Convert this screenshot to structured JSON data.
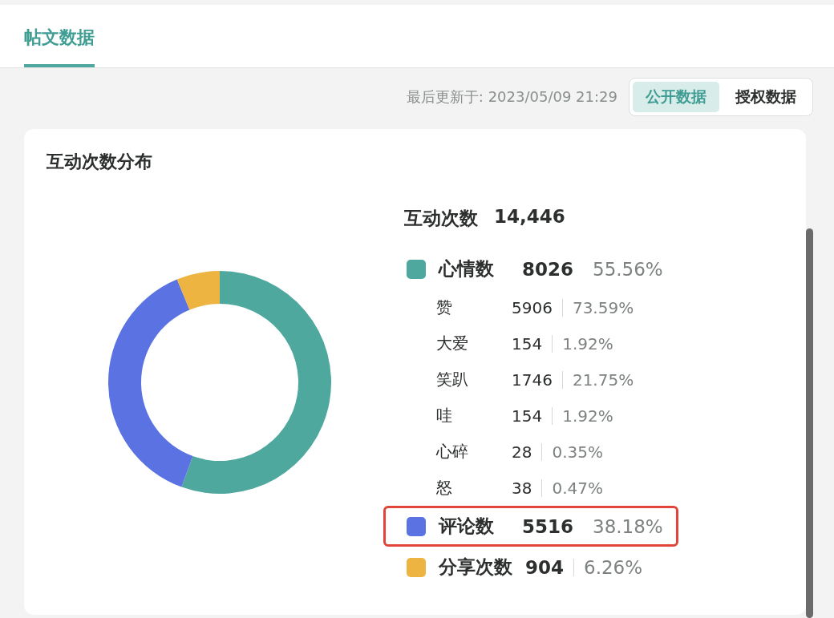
{
  "tabs": [
    {
      "label": "帖文数据",
      "selected": true
    }
  ],
  "last_updated": "最后更新于: 2023/05/09 21:29",
  "data_toggle": [
    {
      "label": "公开数据",
      "selected": true
    },
    {
      "label": "授权数据",
      "selected": false
    }
  ],
  "card": {
    "title": "互动次数分布",
    "total_label": "互动次数",
    "total_value": "14,446",
    "chart_data": {
      "type": "donut",
      "values": [
        55.56,
        38.18,
        6.26
      ]
    },
    "groups": [
      {
        "label": "心情数",
        "count": "8026",
        "percent": "55.56%",
        "color": "#4fa89e",
        "highlighted": false,
        "children": [
          {
            "label": "赞",
            "count": "5906",
            "percent": "73.59%"
          },
          {
            "label": "大爱",
            "count": "154",
            "percent": "1.92%"
          },
          {
            "label": "笑趴",
            "count": "1746",
            "percent": "21.75%"
          },
          {
            "label": "哇",
            "count": "154",
            "percent": "1.92%"
          },
          {
            "label": "心碎",
            "count": "28",
            "percent": "0.35%"
          },
          {
            "label": "怒",
            "count": "38",
            "percent": "0.47%"
          }
        ]
      },
      {
        "label": "评论数",
        "count": "5516",
        "percent": "38.18%",
        "color": "#5b73e2",
        "highlighted": true
      },
      {
        "label": "分享次数",
        "count": "904",
        "percent": "6.26%",
        "color": "#edb441",
        "highlighted": false
      }
    ]
  }
}
